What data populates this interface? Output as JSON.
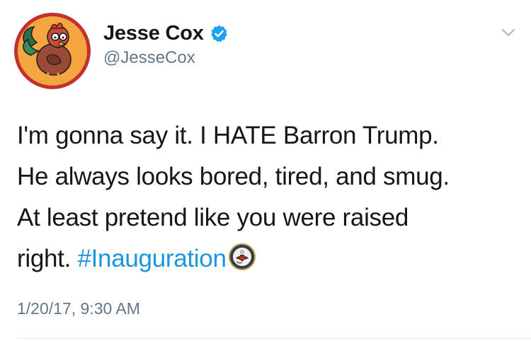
{
  "author": {
    "display_name": "Jesse Cox",
    "handle": "@JesseCox",
    "verified": true
  },
  "tweet": {
    "lines": [
      "I'm gonna say it. I HATE Barron Trump.",
      "He always looks bored, tired, and smug.",
      "At least pretend like you were raised"
    ],
    "last_line_prefix": "right. ",
    "hashtag": "#Inauguration",
    "emoji": "presidential-seal-emoji"
  },
  "timestamp": "1/20/17, 9:30 AM",
  "colors": {
    "hashtag": "#1b95e0",
    "verified_badge": "#1da1f2",
    "secondary_text": "#657786",
    "avatar_background": "#f4a640",
    "avatar_ring": "#c4302b"
  },
  "icons": {
    "avatar": "rooster-avatar",
    "badge": "verified-badge-icon",
    "menu": "chevron-down-icon"
  }
}
